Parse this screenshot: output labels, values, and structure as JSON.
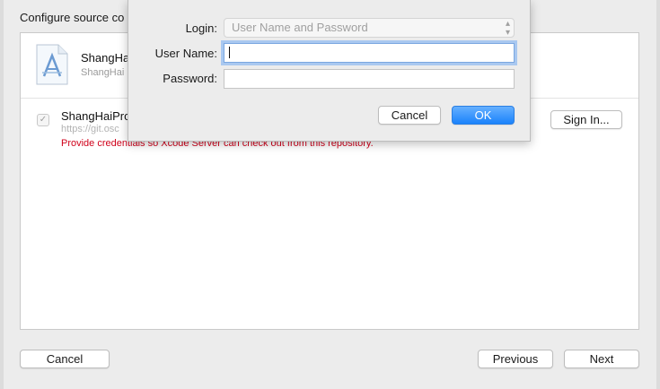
{
  "sheet": {
    "title": "Configure source co",
    "project": {
      "name": "ShangHa",
      "subtitle": "ShangHai",
      "icon": "xcode-app-icon"
    },
    "repository": {
      "checked": true,
      "name": "ShangHaiPro",
      "url": "https://git.osc",
      "warning": "Provide credentials so Xcode Server can check out from this repository.",
      "sign_in_label": "Sign In..."
    },
    "cancel_label": "Cancel",
    "previous_label": "Previous",
    "next_label": "Next"
  },
  "popover": {
    "login_label": "Login:",
    "login_value": "User Name and Password",
    "username_label": "User Name:",
    "username_value": "",
    "password_label": "Password:",
    "password_value": "",
    "cancel_label": "Cancel",
    "ok_label": "OK"
  },
  "colors": {
    "accent": "#1a82fb",
    "warning": "#d0021b"
  }
}
